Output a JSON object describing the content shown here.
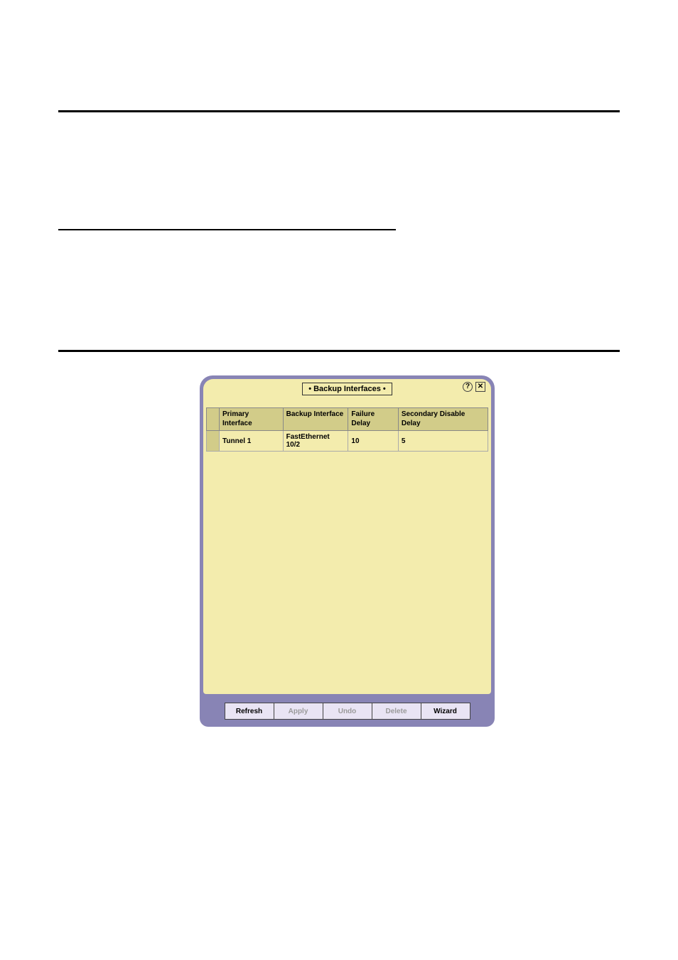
{
  "panel": {
    "title": "• Backup Interfaces •",
    "icons": {
      "help": "?",
      "close": "✕"
    },
    "columns": [
      "Primary Interface",
      "Backup Interface",
      "Failure Delay",
      "Secondary Disable Delay"
    ],
    "rows": [
      {
        "primary": "Tunnel 1",
        "backup": "FastEthernet 10/2",
        "failure_delay": "10",
        "secondary_disable_delay": "5"
      }
    ],
    "buttons": {
      "refresh": "Refresh",
      "apply": "Apply",
      "undo": "Undo",
      "delete": "Delete",
      "wizard": "Wizard"
    }
  }
}
